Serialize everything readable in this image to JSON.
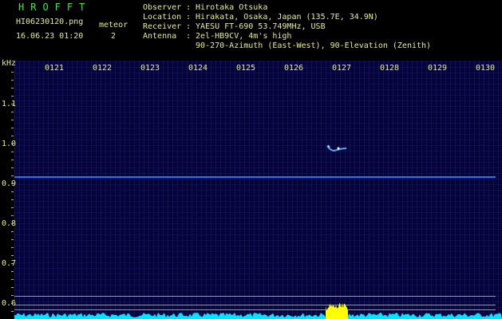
{
  "header": {
    "brand": "HROFFT",
    "filename": "HI06230120.png",
    "datetime": "16.06.23 01:20",
    "meteor_label": "meteor",
    "meteor_count": "2",
    "meta": [
      {
        "key": "Observer",
        "value": ": Hirotaka Otsuka"
      },
      {
        "key": "Location",
        "value": ": Hirakata, Osaka, Japan (135.7E, 34.9N)"
      },
      {
        "key": "Receiver",
        "value": ": YAESU FT-690 53.749MHz, USB"
      },
      {
        "key": "Antenna",
        "value": ": 2el-HB9CV, 4m's high"
      },
      {
        "key": "",
        "value": "  90-270-Azimuth (East-West), 90-Elevation (Zenith)"
      }
    ]
  },
  "axes": {
    "y_unit": "kHz",
    "x_ticks": [
      "0121",
      "0122",
      "0123",
      "0124",
      "0125",
      "0126",
      "0127",
      "0128",
      "0129",
      "0130"
    ],
    "y_ticks": [
      "1.1",
      "1.0",
      "0.9",
      "0.8",
      "0.7",
      "0.6"
    ]
  },
  "colors": {
    "label_text": "#e8f07a",
    "brand": "#3ee84a",
    "background": "#04043a",
    "carrier": "#2f7dff",
    "noise_floor": "#00e5ff",
    "burst": "#ffff00"
  }
}
